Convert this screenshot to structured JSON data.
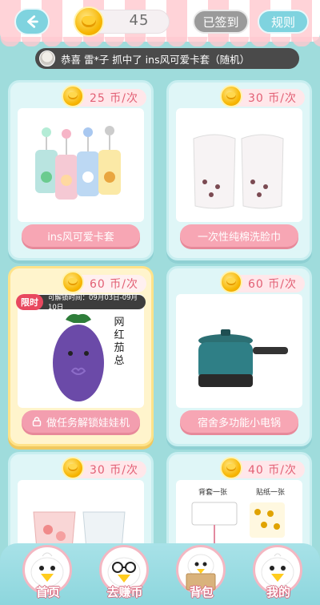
{
  "header": {
    "coins": "45",
    "signed_label": "已签到",
    "rules_label": "规则"
  },
  "ticker": {
    "text": "恭喜 雷*子 抓中了 ins风可爱卡套（随机）"
  },
  "cards": [
    {
      "price": "25 币/次",
      "name": "ins风可爱卡套"
    },
    {
      "price": "30 币/次",
      "name": "一次性纯棉洗脸巾"
    },
    {
      "price": "60 币/次",
      "name": "做任务解锁娃娃机",
      "limit_tag": "限时",
      "unlock_time": "可解锁时间：09月03日-09月10日",
      "plush_label": "网红茄总"
    },
    {
      "price": "60 币/次",
      "name": "宿舍多功能小电锅"
    },
    {
      "price": "30 币/次",
      "name": ""
    },
    {
      "price": "40 币/次",
      "name": "",
      "label_a": "背套一张",
      "label_b": "贴纸一张"
    }
  ],
  "nav": {
    "home": "首页",
    "earn": "去赚币",
    "bag": "背包",
    "mine": "我的"
  },
  "colors": {
    "accent": "#7fd3df",
    "pink": "#f7a6b4",
    "price_text": "#e25f74",
    "background": "#9fdcdc"
  },
  "icons": [
    "back-arrow-icon",
    "coin-icon",
    "lock-icon",
    "avatar-icon"
  ]
}
